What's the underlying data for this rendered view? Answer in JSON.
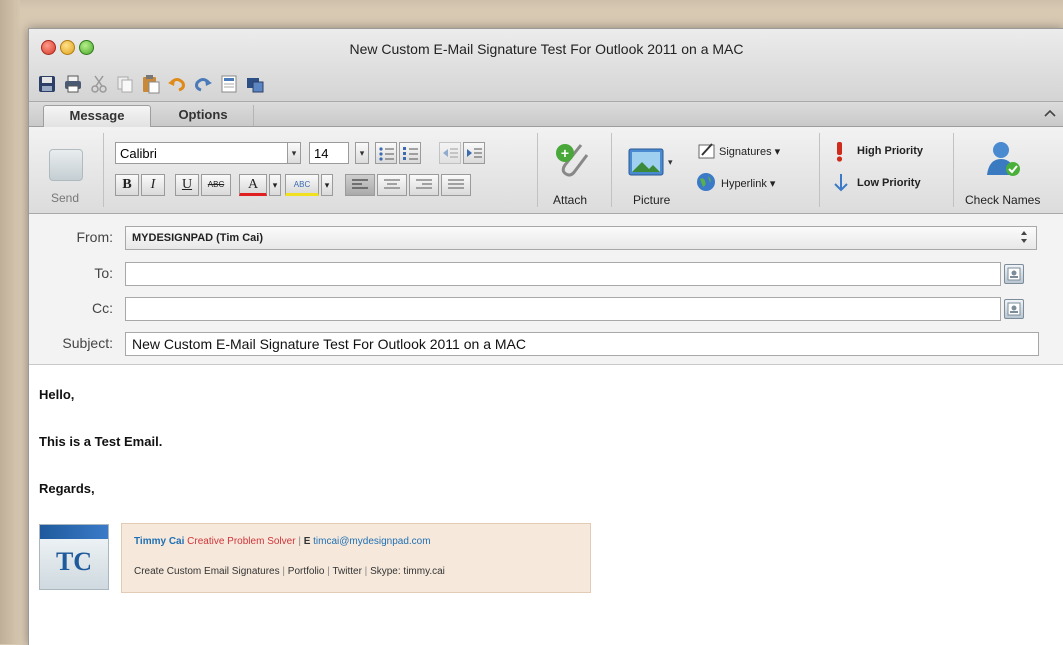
{
  "window": {
    "title": "New Custom E-Mail Signature Test For Outlook 2011 on a MAC"
  },
  "tabs": {
    "message": "Message",
    "options": "Options"
  },
  "ribbon": {
    "send_label": "Send",
    "font_name": "Calibri",
    "font_size": "14",
    "bold": "B",
    "italic": "I",
    "underline": "U",
    "strike": "ABC",
    "font_color": "A",
    "highlight": "ABC",
    "attach_label": "Attach",
    "picture_label": "Picture",
    "signatures_label": "Signatures",
    "hyperlink_label": "Hyperlink",
    "high_priority_label": "High Priority",
    "low_priority_label": "Low Priority",
    "check_names_label": "Check Names",
    "dropdown_caret": "▾"
  },
  "header": {
    "from_label": "From:",
    "from_value": "MYDESIGNPAD (Tim Cai)",
    "to_label": "To:",
    "cc_label": "Cc:",
    "subject_label": "Subject:",
    "subject_value": "New Custom E-Mail Signature Test For Outlook 2011 on a MAC"
  },
  "body": {
    "line1": "Hello,",
    "line2": "This is a Test Email.",
    "line3": "Regards,"
  },
  "signature": {
    "logo_text": "TC",
    "name": "Timmy Cai",
    "title": "Creative Problem Solver",
    "sep1": " | ",
    "email_prefix": "E",
    "email": "timcai@mydesignpad.com",
    "link1": "Create Custom Email Signatures",
    "link2": "Portfolio",
    "link3": "Twitter",
    "skype": "Skype: timmy.cai",
    "sep": " | "
  },
  "colors": {
    "sig_name": "#1f6fb4",
    "sig_title": "#d0343a",
    "sig_bg": "#f6e9dc",
    "logo_tc": "#1e5a9c"
  }
}
